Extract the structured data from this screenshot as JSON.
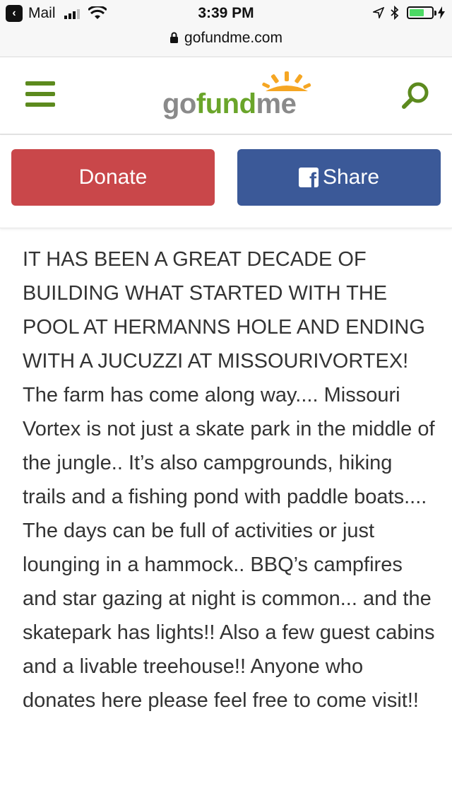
{
  "status_bar": {
    "back_app": "Mail",
    "time": "3:39 PM",
    "url": "gofundme.com"
  },
  "header": {
    "logo": {
      "go": "go",
      "fund": "fund",
      "me": "me"
    }
  },
  "actions": {
    "donate_label": "Donate",
    "share_label": "Share"
  },
  "story": {
    "text": "IT HAS BEEN A GREAT DECADE OF BUILDING WHAT STARTED WITH THE POOL AT HERMANNS HOLE AND ENDING WITH A JUCUZZI AT MISSOURIVORTEX!  The farm has come along way.... Missouri Vortex is not just a skate park in the middle of the jungle.. It’s also campgrounds, hiking trails and a fishing pond with paddle boats.... The days can be full of activities or just lounging in a hammock.. BBQ’s campfires and star gazing at night is common... and the skatepark has lights!! Also a few guest cabins and a livable treehouse!! Anyone who donates here please feel free to come visit!!"
  },
  "colors": {
    "brand_green": "#5c8a1e",
    "donate_red": "#c9474a",
    "facebook_blue": "#3b5998"
  },
  "icons": [
    "back-icon",
    "cellular-signal-icon",
    "wifi-icon",
    "location-arrow-icon",
    "bluetooth-icon",
    "battery-icon",
    "charging-icon",
    "lock-icon",
    "menu-icon",
    "search-icon",
    "facebook-icon"
  ]
}
